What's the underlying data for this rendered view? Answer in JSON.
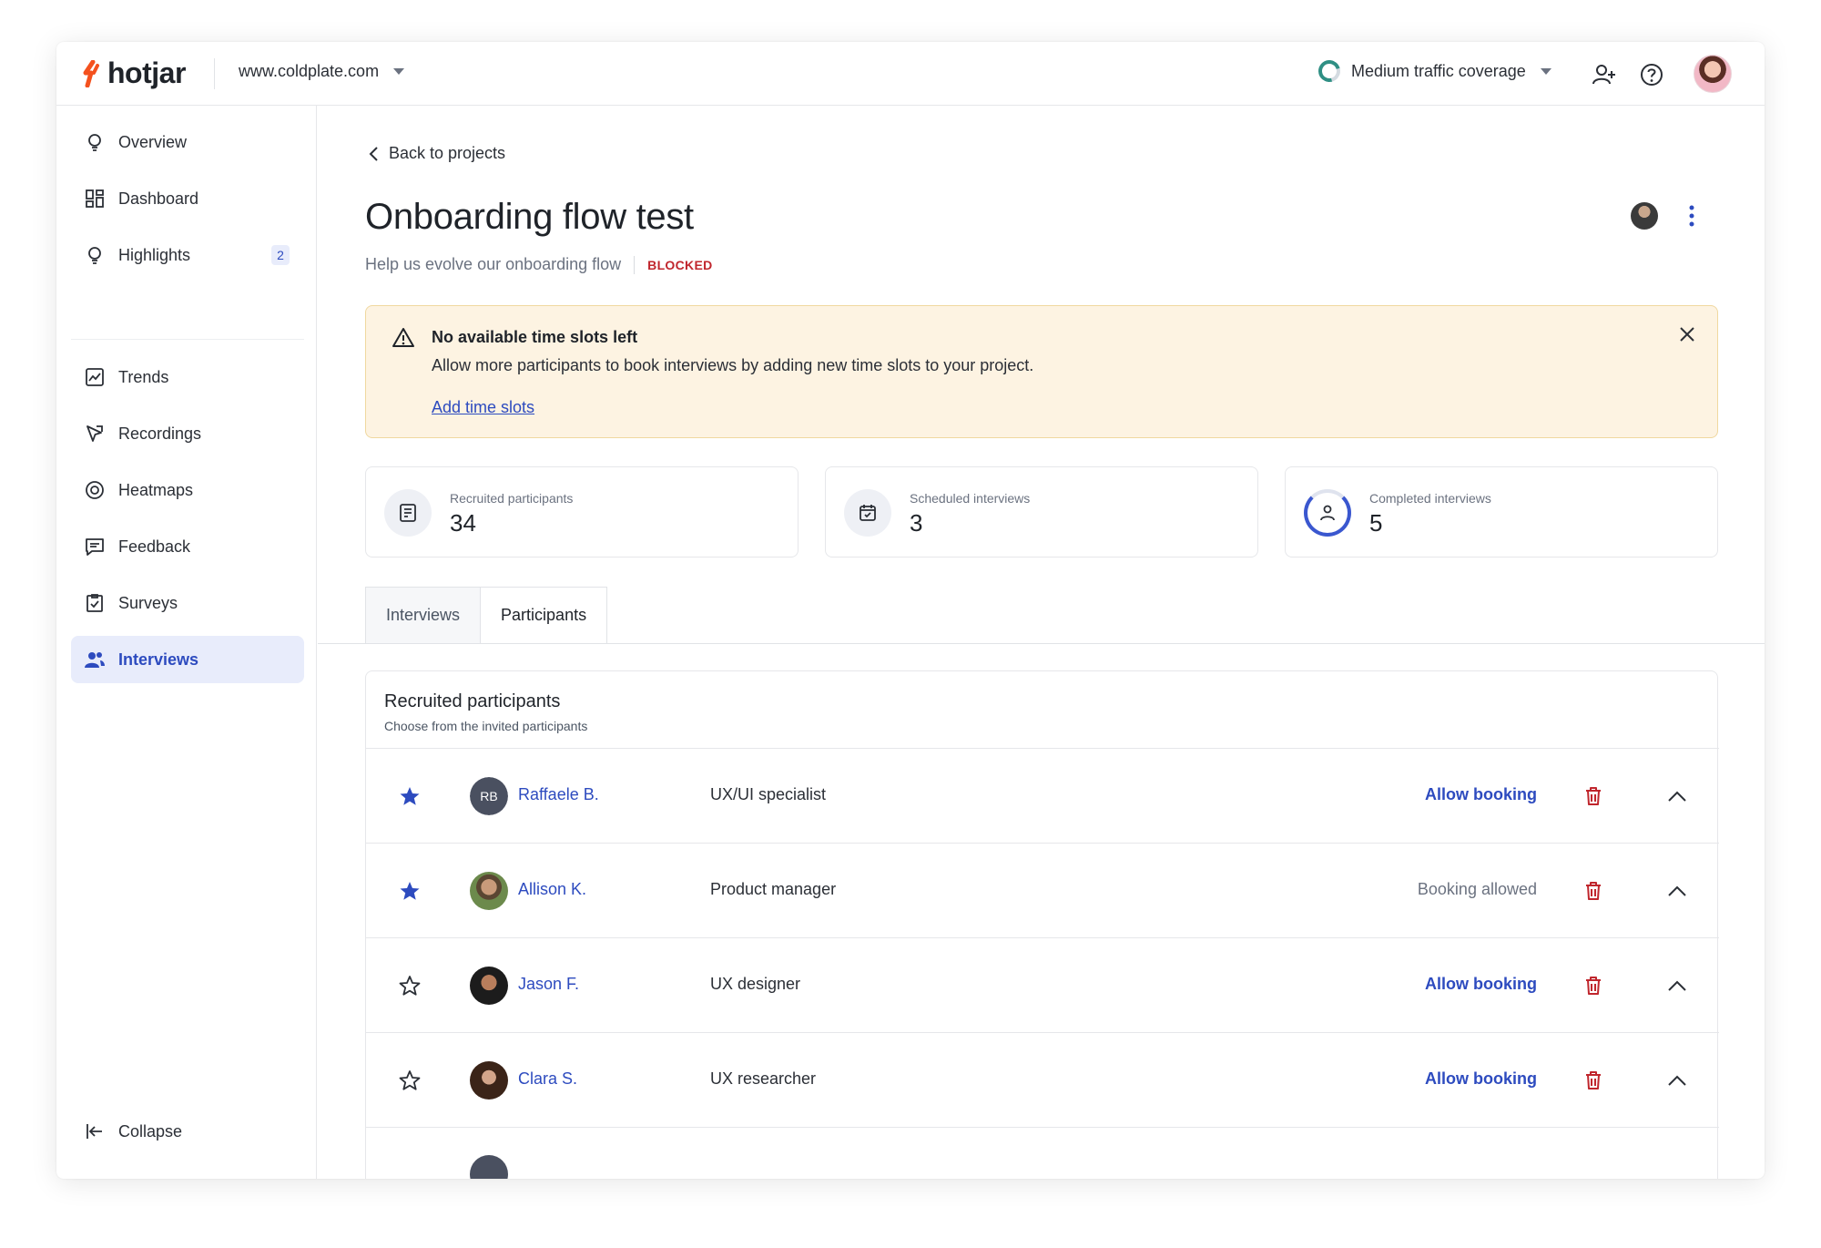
{
  "topbar": {
    "logo_text": "hotjar",
    "site": "www.coldplate.com",
    "traffic_label": "Medium traffic coverage"
  },
  "sidebar": {
    "items": [
      {
        "label": "Overview",
        "icon": "lightbulb-icon"
      },
      {
        "label": "Dashboard",
        "icon": "dashboard-icon"
      },
      {
        "label": "Highlights",
        "icon": "lightbulb-icon",
        "badge": "2"
      },
      {
        "label": "Trends",
        "icon": "trends-icon"
      },
      {
        "label": "Recordings",
        "icon": "recordings-icon"
      },
      {
        "label": "Heatmaps",
        "icon": "heatmaps-icon"
      },
      {
        "label": "Feedback",
        "icon": "feedback-icon"
      },
      {
        "label": "Surveys",
        "icon": "surveys-icon"
      },
      {
        "label": "Interviews",
        "icon": "interviews-icon",
        "active": true
      }
    ],
    "collapse_label": "Collapse"
  },
  "main": {
    "back_label": "Back to projects",
    "title": "Onboarding flow test",
    "subtitle": "Help us evolve our onboarding flow",
    "status": "BLOCKED",
    "alert": {
      "title": "No available time slots left",
      "description": "Allow more participants to book interviews by adding new time slots to your project.",
      "link": "Add time slots"
    },
    "stats": [
      {
        "label": "Recruited participants",
        "value": "34"
      },
      {
        "label": "Scheduled interviews",
        "value": "3"
      },
      {
        "label": "Completed interviews",
        "value": "5"
      }
    ],
    "tabs": [
      {
        "label": "Interviews"
      },
      {
        "label": "Participants",
        "active": true
      }
    ],
    "panel": {
      "title": "Recruited participants",
      "subtitle": "Choose from the invited participants",
      "rows": [
        {
          "initials": "RB",
          "name": "Raffaele B.",
          "role": "UX/UI specialist",
          "action": "Allow booking",
          "starred": true
        },
        {
          "name": "Allison K.",
          "role": "Product manager",
          "action": "Booking allowed",
          "starred": true
        },
        {
          "name": "Jason F.",
          "role": "UX designer",
          "action": "Allow booking",
          "starred": false
        },
        {
          "name": "Clara S.",
          "role": "UX researcher",
          "action": "Allow booking",
          "starred": false
        }
      ]
    }
  },
  "colors": {
    "accent": "#2d4bbf",
    "danger": "#c0262d",
    "alert_bg": "#fdf3e2",
    "logo_orange": "#f4511e"
  }
}
